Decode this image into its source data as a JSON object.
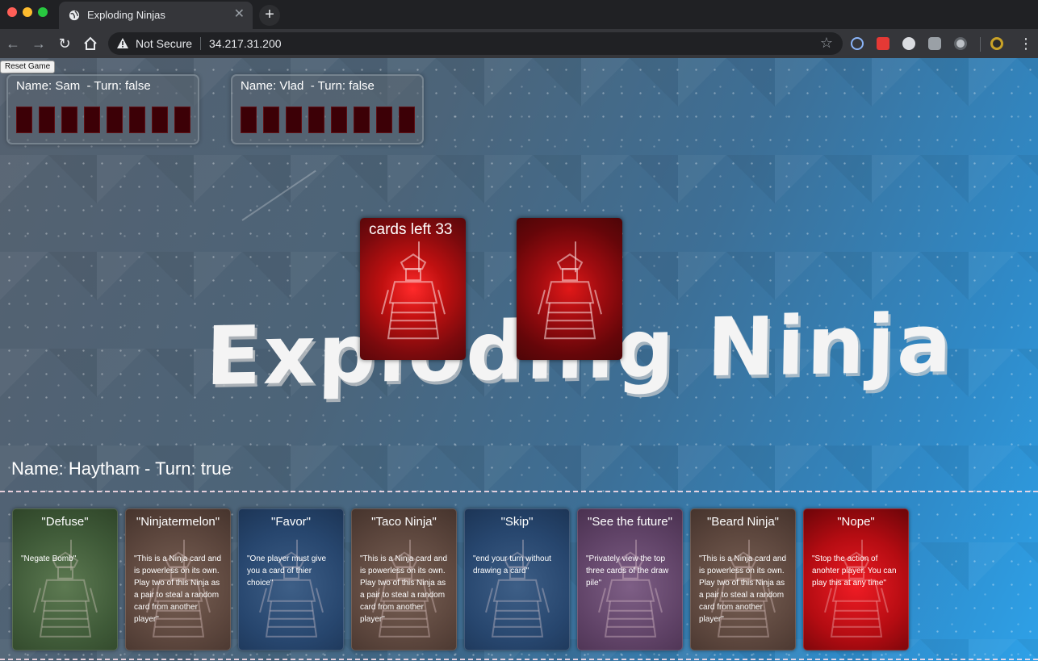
{
  "browser": {
    "tab_title": "Exploding Ninjas",
    "tab_close": "✕",
    "new_tab": "+",
    "security_label": "Not Secure",
    "url": "34.217.31.200"
  },
  "game": {
    "reset_label": "Reset Game",
    "opponents": [
      {
        "label": "Name: Sam  - Turn: false",
        "card_count": 8
      },
      {
        "label": "Name: Vlad  - Turn: false",
        "card_count": 8
      }
    ],
    "logo_text": "Exploding Ninja",
    "cards_left_label": "cards left 33",
    "player_label": "Name: Haytham - Turn: true",
    "hand": [
      {
        "title": "\"Defuse\"",
        "desc": "\"Negate Bomb\"",
        "theme": "green"
      },
      {
        "title": "\"Ninjatermelon\"",
        "desc": "\"This is a Ninja card and is powerless on its own. Play two of this Ninja as a pair to steal a random card from another player\"",
        "theme": "brown"
      },
      {
        "title": "\"Favor\"",
        "desc": "\"One player must give you a card of thier choice\"",
        "theme": "blue"
      },
      {
        "title": "\"Taco Ninja\"",
        "desc": "\"This is a Ninja card and is powerless on its own. Play two of this Ninja as a pair to steal a random card from another player\"",
        "theme": "brown"
      },
      {
        "title": "\"Skip\"",
        "desc": "\"end your turn without drawing a card\"",
        "theme": "blue"
      },
      {
        "title": "\"See the future\"",
        "desc": "\"Privately view the top three cards of the draw pile\"",
        "theme": "purple"
      },
      {
        "title": "\"Beard Ninja\"",
        "desc": "\"This is a Ninja card and is powerless on its own. Play two of this Ninja as a pair to steal a random card from another player\"",
        "theme": "brown"
      },
      {
        "title": "\"Nope\"",
        "desc": "\"Stop the action of anohter player. You can play this at any time\"",
        "theme": "red"
      }
    ]
  },
  "colors": {
    "card_back_red": "#c01010",
    "opponent_card": "#3c0006",
    "page_blue": "#2ea1e8"
  }
}
